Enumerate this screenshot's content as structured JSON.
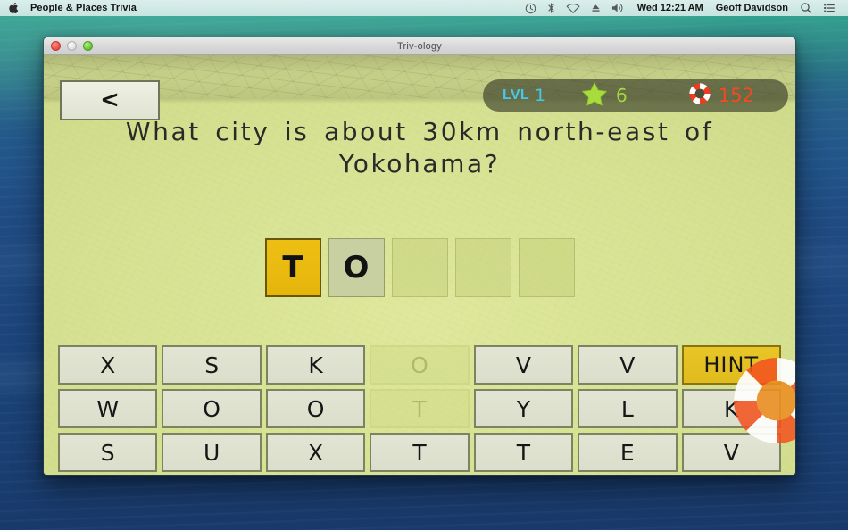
{
  "menubar": {
    "apple_icon": "apple-logo-icon",
    "app_name": "People & Places Trivia",
    "status_icons": [
      "clock-icon",
      "bluetooth-icon",
      "wifi-icon",
      "eject-icon",
      "volume-icon"
    ],
    "datetime": "Wed 12:21 AM",
    "user": "Geoff Davidson",
    "search_icon": "search-icon",
    "notification_icon": "notification-list-icon"
  },
  "window": {
    "title": "Triv-ology",
    "traffic_lights": [
      "close-button",
      "minimize-button",
      "zoom-button"
    ]
  },
  "game": {
    "back_button_label": "<",
    "hud": {
      "level_label": "LVL",
      "level_value": "1",
      "star_icon": "star-icon",
      "star_value": "6",
      "life_icon": "lifebuoy-icon",
      "life_value": "152",
      "level_color": "#45c8ea",
      "star_color": "#a6d93b",
      "life_color": "#f04b23"
    },
    "question": "What city is about 30km north-east of Yokohama?",
    "answer_slots": [
      {
        "letter": "T",
        "state": "active"
      },
      {
        "letter": "O",
        "state": "filled"
      },
      {
        "letter": "",
        "state": "empty"
      },
      {
        "letter": "",
        "state": "empty"
      },
      {
        "letter": "",
        "state": "empty"
      }
    ],
    "keyboard_rows": [
      [
        {
          "label": "X",
          "state": "available"
        },
        {
          "label": "S",
          "state": "available"
        },
        {
          "label": "K",
          "state": "available"
        },
        {
          "label": "O",
          "state": "used"
        },
        {
          "label": "V",
          "state": "available"
        },
        {
          "label": "V",
          "state": "available"
        },
        {
          "label": "HINT",
          "state": "hint"
        }
      ],
      [
        {
          "label": "W",
          "state": "available"
        },
        {
          "label": "O",
          "state": "available"
        },
        {
          "label": "O",
          "state": "available"
        },
        {
          "label": "T",
          "state": "used"
        },
        {
          "label": "Y",
          "state": "available"
        },
        {
          "label": "L",
          "state": "available"
        },
        {
          "label": "K",
          "state": "available"
        }
      ],
      [
        {
          "label": "S",
          "state": "available"
        },
        {
          "label": "U",
          "state": "available"
        },
        {
          "label": "X",
          "state": "available"
        },
        {
          "label": "T",
          "state": "available"
        },
        {
          "label": "T",
          "state": "available"
        },
        {
          "label": "E",
          "state": "available"
        },
        {
          "label": "V",
          "state": "available"
        }
      ]
    ],
    "hint_decoration_icon": "lifebuoy-icon",
    "board_color": "#d6e192",
    "hint_color": "#e9c627",
    "active_slot_color": "#eebf13"
  }
}
